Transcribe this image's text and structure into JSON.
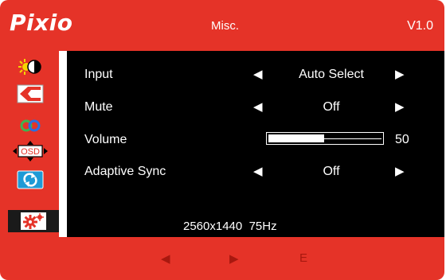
{
  "header": {
    "logo": "Pixio",
    "title": "Misc.",
    "version": "V1.0"
  },
  "sidebar": {
    "tabs": [
      {
        "icon": "brightness-contrast-icon"
      },
      {
        "icon": "image-icon"
      },
      {
        "icon": "color-icon"
      },
      {
        "icon": "osd-icon",
        "text": "OSD"
      },
      {
        "icon": "reset-icon"
      },
      {
        "icon": "misc-settings-icon",
        "active": true
      }
    ]
  },
  "menu": {
    "rows": [
      {
        "label": "Input",
        "value": "Auto Select",
        "left_arrow": "◀",
        "right_arrow": "▶"
      },
      {
        "label": "Mute",
        "value": "Off",
        "left_arrow": "◀",
        "right_arrow": "▶"
      },
      {
        "label": "Volume",
        "value": "50",
        "level": 0.5
      },
      {
        "label": "Adaptive Sync",
        "value": "Off",
        "left_arrow": "◀",
        "right_arrow": "▶"
      }
    ]
  },
  "status": {
    "resolution": "2560x1440",
    "refresh": "75Hz"
  },
  "footer": {
    "left": "◀",
    "right": "▶",
    "exit": "E"
  },
  "colors": {
    "brand_red": "#e53328",
    "panel_black": "#000000",
    "footer_text": "#a8180f"
  }
}
